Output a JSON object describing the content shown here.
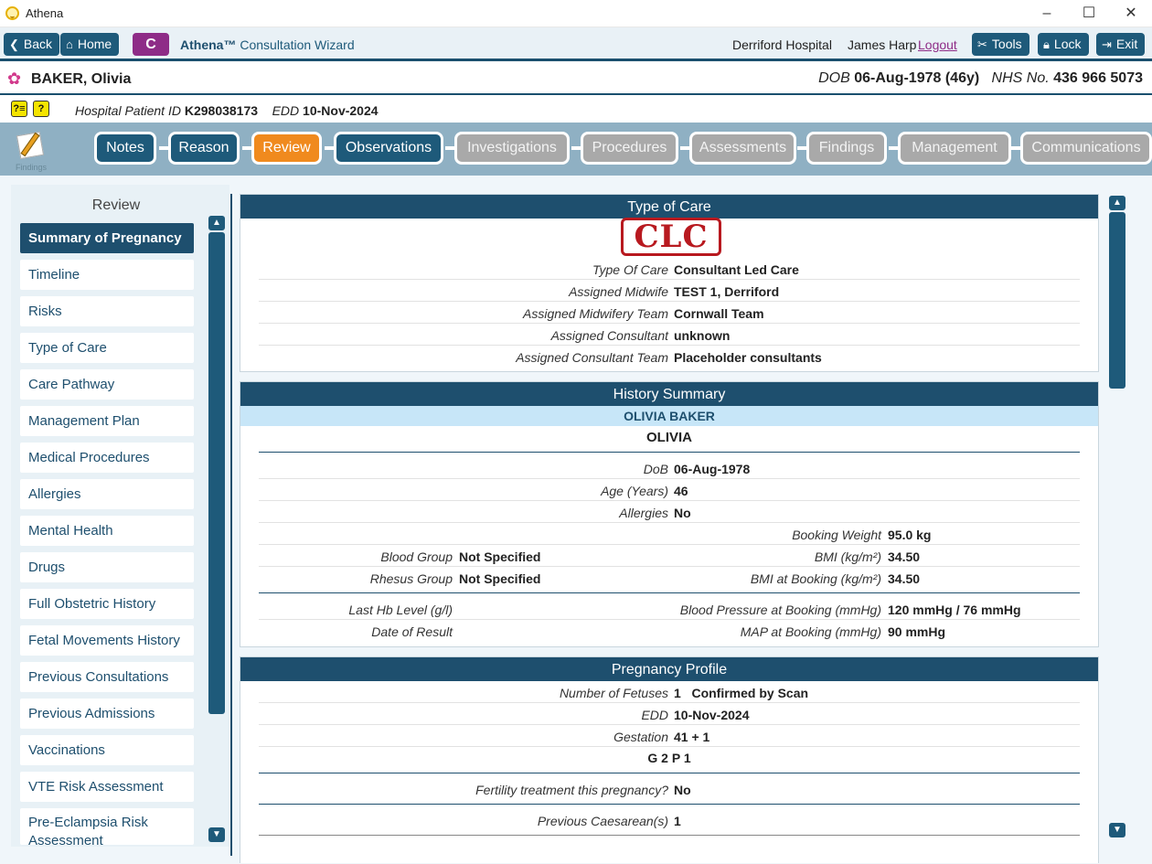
{
  "window": {
    "title": "Athena",
    "minimize": "–",
    "maximize": "☐",
    "close": "✕"
  },
  "toolbar": {
    "back": "Back",
    "home": "Home",
    "c_button": "C",
    "app_name": "Athena™",
    "wizard_title": "Consultation Wizard",
    "hospital": "Derriford Hospital",
    "user": "James Harp",
    "logout": "Logout",
    "tools": "Tools",
    "lock": "Lock",
    "exit": "Exit"
  },
  "patient": {
    "name": "BAKER, Olivia",
    "dob_label": "DOB",
    "dob": "06-Aug-1978 (46y)",
    "nhs_label": "NHS No.",
    "nhs": "436 966 5073",
    "hpid_label": "Hospital Patient ID",
    "hpid": "K298038173",
    "edd_label": "EDD",
    "edd": "10-Nov-2024"
  },
  "tabs": [
    {
      "label": "Notes",
      "state": "on"
    },
    {
      "label": "Reason",
      "state": "on"
    },
    {
      "label": "Review",
      "state": "sel"
    },
    {
      "label": "Observations",
      "state": "on"
    },
    {
      "label": "Investigations",
      "state": "off"
    },
    {
      "label": "Procedures",
      "state": "off"
    },
    {
      "label": "Assessments",
      "state": "off"
    },
    {
      "label": "Findings",
      "state": "off"
    },
    {
      "label": "Management",
      "state": "off"
    },
    {
      "label": "Communications",
      "state": "off"
    }
  ],
  "findings_icon_label": "Findings",
  "review": {
    "title": "Review",
    "items": [
      "Summary of Pregnancy",
      "Timeline",
      "Risks",
      "Type of Care",
      "Care Pathway",
      "Management Plan",
      "Medical Procedures",
      "Allergies",
      "Mental Health",
      "Drugs",
      "Full Obstetric History",
      "Fetal Movements History",
      "Previous Consultations",
      "Previous Admissions",
      "Vaccinations",
      "VTE Risk Assessment",
      "Pre-Eclampsia Risk Assessment"
    ]
  },
  "type_of_care": {
    "header": "Type of Care",
    "stamp": "CLC",
    "rows": [
      {
        "k": "Type Of Care",
        "v": "Consultant Led Care"
      },
      {
        "k": "Assigned Midwife",
        "v": "TEST 1, Derriford"
      },
      {
        "k": "Assigned Midwifery Team",
        "v": "Cornwall Team"
      },
      {
        "k": "Assigned Consultant",
        "v": "unknown"
      },
      {
        "k": "Assigned Consultant Team",
        "v": "Placeholder consultants"
      }
    ]
  },
  "history": {
    "header": "History Summary",
    "name_bar": "OLIVIA BAKER",
    "first_name": "OLIVIA",
    "rows": [
      {
        "k": "DoB",
        "v": "06-Aug-1978"
      },
      {
        "k": "Age (Years)",
        "v": "46"
      },
      {
        "k": "Allergies",
        "v": "No"
      }
    ],
    "booking_weight_label": "Booking Weight",
    "booking_weight": "95.0 kg",
    "blood_group_label": "Blood Group",
    "blood_group": "Not Specified",
    "bmi_label": "BMI (kg/m²)",
    "bmi": "34.50",
    "rhesus_label": "Rhesus Group",
    "rhesus": "Not Specified",
    "bmi_booking_label": "BMI at Booking (kg/m²)",
    "bmi_booking": "34.50",
    "hb_label": "Last Hb Level (g/l)",
    "bp_label": "Blood Pressure at Booking (mmHg)",
    "bp": "120 mmHg / 76 mmHg",
    "result_label": "Date of Result",
    "map_label": "MAP at Booking (mmHg)",
    "map": "90 mmHg"
  },
  "pregnancy": {
    "header": "Pregnancy Profile",
    "fetuses_label": "Number of Fetuses",
    "fetuses": "1",
    "fetuses_note": "Confirmed by Scan",
    "edd_label": "EDD",
    "edd": "10-Nov-2024",
    "gestation_label": "Gestation",
    "gestation": "41 + 1",
    "gp": "G 2 P 1",
    "fertility_label": "Fertility treatment this pregnancy?",
    "fertility": "No",
    "caesarean_label": "Previous Caesarean(s)",
    "caesarean": "1"
  },
  "colors": {
    "primary": "#1e4f6e",
    "selected_tab": "#f08a1e",
    "disabled_tab": "#a9a9a9",
    "c_button": "#8e2c87",
    "stamp": "#b8191f"
  }
}
